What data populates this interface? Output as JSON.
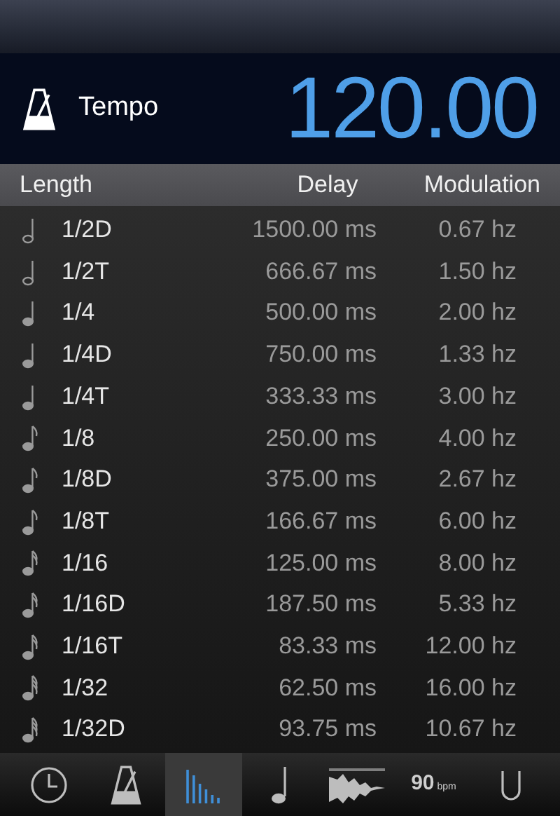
{
  "header": {
    "label": "Tempo",
    "value": "120.00"
  },
  "table": {
    "columns": [
      "Length",
      "Delay",
      "Modulation"
    ],
    "rows": [
      {
        "kind": "half",
        "length": "1/2D",
        "delay": "1500.00 ms",
        "modulation": "0.67 hz"
      },
      {
        "kind": "half",
        "length": "1/2T",
        "delay": "666.67 ms",
        "modulation": "1.50 hz"
      },
      {
        "kind": "quarter",
        "length": "1/4",
        "delay": "500.00 ms",
        "modulation": "2.00 hz"
      },
      {
        "kind": "quarter",
        "length": "1/4D",
        "delay": "750.00 ms",
        "modulation": "1.33 hz"
      },
      {
        "kind": "quarter",
        "length": "1/4T",
        "delay": "333.33 ms",
        "modulation": "3.00 hz"
      },
      {
        "kind": "eighth",
        "length": "1/8",
        "delay": "250.00 ms",
        "modulation": "4.00 hz"
      },
      {
        "kind": "eighth",
        "length": "1/8D",
        "delay": "375.00 ms",
        "modulation": "2.67 hz"
      },
      {
        "kind": "eighth",
        "length": "1/8T",
        "delay": "166.67 ms",
        "modulation": "6.00 hz"
      },
      {
        "kind": "sixteenth",
        "length": "1/16",
        "delay": "125.00 ms",
        "modulation": "8.00 hz"
      },
      {
        "kind": "sixteenth",
        "length": "1/16D",
        "delay": "187.50 ms",
        "modulation": "5.33 hz"
      },
      {
        "kind": "sixteenth",
        "length": "1/16T",
        "delay": "83.33 ms",
        "modulation": "12.00 hz"
      },
      {
        "kind": "thirtysecond",
        "length": "1/32",
        "delay": "62.50 ms",
        "modulation": "16.00 hz"
      },
      {
        "kind": "thirtysecond",
        "length": "1/32D",
        "delay": "93.75 ms",
        "modulation": "10.67 hz"
      }
    ]
  },
  "tab_bar": [
    {
      "kind": "clock",
      "selected": false
    },
    {
      "kind": "metronome",
      "selected": false
    },
    {
      "kind": "bars",
      "selected": true
    },
    {
      "kind": "note",
      "selected": false
    },
    {
      "kind": "wave",
      "selected": false
    },
    {
      "kind": "bpm",
      "selected": false,
      "value": "90",
      "unit": "bpm"
    },
    {
      "kind": "loop",
      "selected": false
    }
  ]
}
